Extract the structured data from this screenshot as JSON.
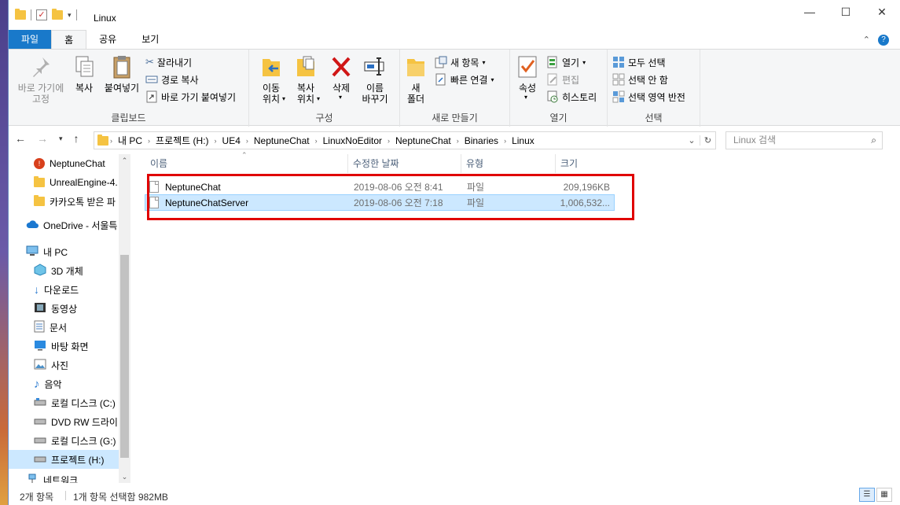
{
  "window": {
    "title": "Linux"
  },
  "tabs": {
    "file": "파일",
    "home": "홈",
    "share": "공유",
    "view": "보기"
  },
  "ribbon": {
    "clipboard": {
      "label": "클립보드",
      "pin": "바로 가기에\n고정",
      "copy": "복사",
      "paste": "붙여넣기",
      "cut": "잘라내기",
      "copy_path": "경로 복사",
      "paste_shortcut": "바로 가기 붙여넣기"
    },
    "organize": {
      "label": "구성",
      "move": "이동\n위치",
      "copyto": "복사\n위치",
      "delete": "삭제",
      "rename": "이름\n바꾸기"
    },
    "new": {
      "label": "새로 만들기",
      "new_folder": "새\n폴더",
      "new_item": "새 항목",
      "easy_access": "빠른 연결"
    },
    "open": {
      "label": "열기",
      "properties": "속성",
      "open": "열기",
      "edit": "편집",
      "history": "히스토리"
    },
    "select": {
      "label": "선택",
      "select_all": "모두 선택",
      "select_none": "선택 안 함",
      "invert": "선택 영역 반전"
    }
  },
  "address": {
    "crumbs": [
      "내 PC",
      "프로젝트 (H:)",
      "UE4",
      "NeptuneChat",
      "LinuxNoEditor",
      "NeptuneChat",
      "Binaries",
      "Linux"
    ],
    "search_placeholder": "Linux 검색"
  },
  "navpane": {
    "items": [
      {
        "label": "NeptuneChat",
        "icon": "folder-alert-icon"
      },
      {
        "label": "UnrealEngine-4.",
        "icon": "folder-icon"
      },
      {
        "label": "카카오톡 받은 파",
        "icon": "folder-icon"
      },
      {
        "label": "OneDrive - 서울특",
        "icon": "cloud-icon"
      },
      {
        "label": "내 PC",
        "icon": "pc-icon"
      },
      {
        "label": "3D 개체",
        "icon": "cube-icon"
      },
      {
        "label": "다운로드",
        "icon": "download-icon"
      },
      {
        "label": "동영상",
        "icon": "video-icon"
      },
      {
        "label": "문서",
        "icon": "document-icon"
      },
      {
        "label": "바탕 화면",
        "icon": "desktop-icon"
      },
      {
        "label": "사진",
        "icon": "picture-icon"
      },
      {
        "label": "음악",
        "icon": "music-icon"
      },
      {
        "label": "로컬 디스크 (C:)",
        "icon": "drive-icon"
      },
      {
        "label": "DVD RW 드라이",
        "icon": "dvd-icon"
      },
      {
        "label": "로컬 디스크 (G:)",
        "icon": "drive-icon"
      },
      {
        "label": "프로젝트 (H:)",
        "icon": "drive-icon"
      },
      {
        "label": "네트워크",
        "icon": "network-icon"
      }
    ]
  },
  "columns": {
    "name": "이름",
    "date": "수정한 날짜",
    "type": "유형",
    "size": "크기"
  },
  "files": [
    {
      "name": "NeptuneChat",
      "date": "2019-08-06 오전 8:41",
      "type": "파일",
      "size": "209,196KB"
    },
    {
      "name": "NeptuneChatServer",
      "date": "2019-08-06 오전 7:18",
      "type": "파일",
      "size": "1,006,532..."
    }
  ],
  "status": {
    "count": "2개 항목",
    "selection": "1개 항목 선택함 982MB"
  },
  "colors": {
    "accent": "#1979ca",
    "selection": "#cce8ff",
    "highlight_box": "#e00000"
  }
}
